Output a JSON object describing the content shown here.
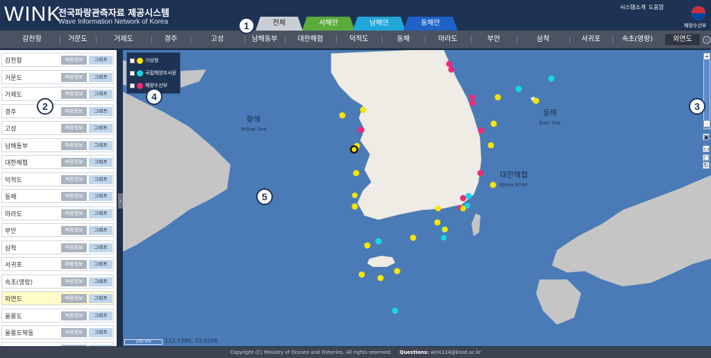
{
  "header": {
    "logo": "WINK",
    "title": "전국파랑관측자료 제공시스템",
    "subtitle": "Wave Information Network of Korea",
    "links": [
      "시스템소개",
      "도움말"
    ],
    "ministry": "해양수산부"
  },
  "tabs": [
    {
      "label": "전체",
      "state": "active"
    },
    {
      "label": "서해안"
    },
    {
      "label": "남해안"
    },
    {
      "label": "동해안"
    }
  ],
  "markers": [
    "1",
    "2",
    "3",
    "4",
    "5"
  ],
  "nav": {
    "items": [
      "감천항",
      "거문도",
      "거제도",
      "경주",
      "고성",
      "남해동부",
      "대한해협",
      "덕적도",
      "동해",
      "마라도",
      "부안",
      "삼척",
      "서귀포",
      "속초(영랑)",
      "외연도"
    ],
    "active": "외연도",
    "next_icon": "chevron-right-icon"
  },
  "sidebar": {
    "info_label": "파랑정보",
    "graph_label": "그래프",
    "selected": "외연도",
    "stations": [
      "감천항",
      "거문도",
      "거제도",
      "경주",
      "고성",
      "남해동부",
      "대한해협",
      "덕적도",
      "동해",
      "마라도",
      "부안",
      "삼척",
      "서귀포",
      "속초(영랑)",
      "외연도",
      "울릉도",
      "울릉도북동"
    ]
  },
  "legend": {
    "items": [
      {
        "label": "기상청",
        "color": "#f5e600"
      },
      {
        "label": "국립해양조사원",
        "color": "#14d8e8"
      },
      {
        "label": "해양수산부",
        "color": "#f0287a"
      }
    ]
  },
  "map": {
    "labels": {
      "yellow_kr": "황해",
      "yellow_en": "Yellow Sea",
      "east_kr": "동해",
      "east_en": "East Sea",
      "strait_kr": "대한해협",
      "strait_en": "Korea Strait"
    },
    "scale": "100 km",
    "coords": "123.7390, 33.9206",
    "zoom_in": "+",
    "zoom_out": "-",
    "colors": {
      "sea": "#4a7bb7",
      "land": "#eeece4",
      "far_land": "#c5c5c5"
    }
  },
  "footer": {
    "copyright": "Copyright (C) Ministry of Oceans and Fisheries. All rights reserved.",
    "questions_label": "Questions:",
    "email": "wink114@kiost.ac.kr"
  }
}
